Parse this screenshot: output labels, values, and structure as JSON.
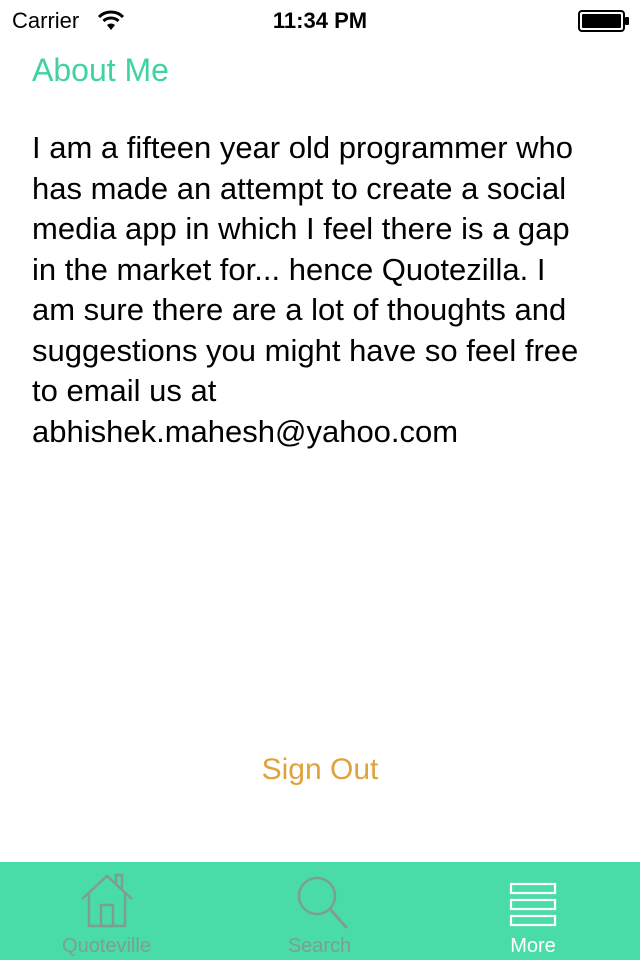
{
  "status_bar": {
    "carrier": "Carrier",
    "time": "11:34 PM",
    "wifi_icon": "wifi-icon",
    "battery_icon": "battery-icon"
  },
  "about": {
    "title": "About Me",
    "body_lines": [
      "I am a fifteen year old programmer who",
      "has made an attempt to create a social",
      "media app in which I feel there is a gap",
      "in the market for... hence Quotezilla. I",
      "am sure there are a lot of thoughts and",
      "suggestions you might have so feel free",
      "to email us at",
      "abhishek.mahesh@yahoo.com"
    ]
  },
  "actions": {
    "sign_out_label": "Sign Out"
  },
  "tab_bar": {
    "tabs": [
      {
        "label": "Quoteville",
        "icon": "home-icon",
        "selected": false
      },
      {
        "label": "Search",
        "icon": "search-icon",
        "selected": false
      },
      {
        "label": "More",
        "icon": "more-lines-icon",
        "selected": true
      }
    ]
  },
  "colors": {
    "accent_green": "#49DCA7",
    "title_green": "#3FD3A0",
    "sign_out_orange": "#E0A33A",
    "tab_inactive": "#7F9E93",
    "tab_active": "#FFFFFF"
  }
}
